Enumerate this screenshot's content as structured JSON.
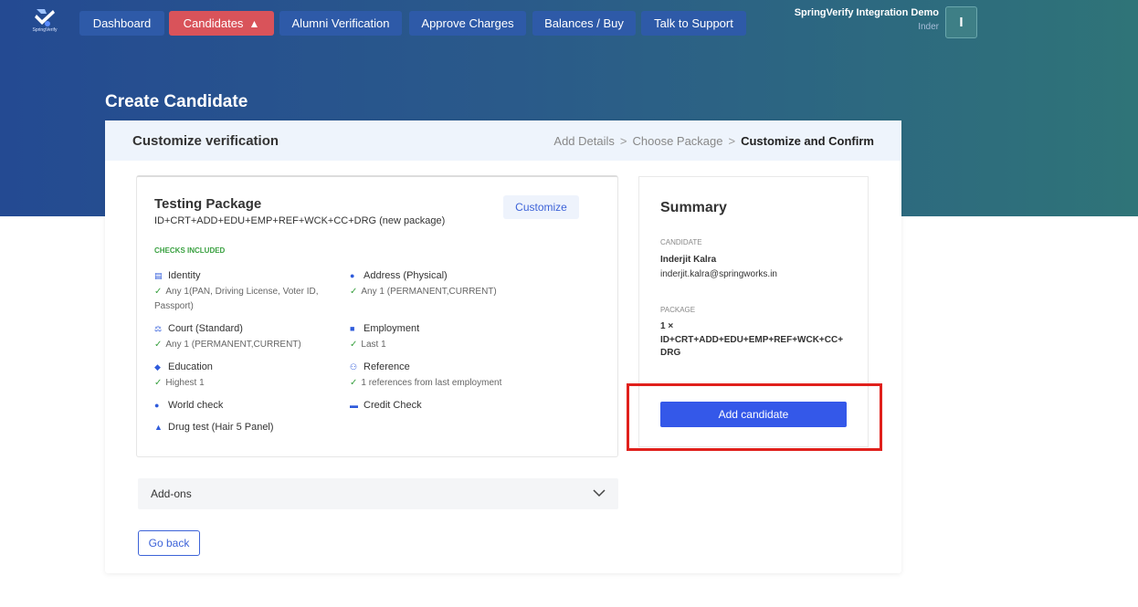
{
  "brand": {
    "logo_text": "SpringVerify"
  },
  "nav": {
    "items": [
      {
        "label": "Dashboard"
      },
      {
        "label": "Candidates"
      },
      {
        "label": "Alumni Verification"
      },
      {
        "label": "Approve Charges"
      },
      {
        "label": "Balances / Buy"
      },
      {
        "label": "Talk to Support"
      }
    ],
    "warn_icon": "warning-icon",
    "colors": {
      "active": "#d9535a",
      "item": "#2e5aa8"
    }
  },
  "user": {
    "org": "SpringVerify Integration Demo",
    "name": "Inder",
    "avatar_initial": "I"
  },
  "page": {
    "title": "Create Candidate"
  },
  "card": {
    "title": "Customize verification",
    "breadcrumb": {
      "step1": "Add Details",
      "step2": "Choose Package",
      "step3": "Customize and Confirm",
      "sep": ">"
    }
  },
  "package": {
    "name": "Testing Package",
    "code": "ID+CRT+ADD+EDU+EMP+REF+WCK+CC+DRG (new package)",
    "customize_label": "Customize",
    "checks_label": "CHECKS INCLUDED",
    "checks": [
      {
        "name": "Identity",
        "desc": "Any 1(PAN, Driving License, Voter ID, Passport)",
        "icon": "id-card-icon"
      },
      {
        "name": "Address (Physical)",
        "desc": "Any 1 (PERMANENT,CURRENT)",
        "icon": "location-pin-icon"
      },
      {
        "name": "Court (Standard)",
        "desc": "Any 1 (PERMANENT,CURRENT)",
        "icon": "gavel-icon"
      },
      {
        "name": "Employment",
        "desc": "Last 1",
        "icon": "briefcase-icon"
      },
      {
        "name": "Education",
        "desc": "Highest 1",
        "icon": "graduation-cap-icon"
      },
      {
        "name": "Reference",
        "desc": "1 references from last employment",
        "icon": "people-icon"
      },
      {
        "name": "World check",
        "desc": "",
        "icon": "globe-icon"
      },
      {
        "name": "Credit Check",
        "desc": "",
        "icon": "credit-card-icon"
      },
      {
        "name": "Drug test (Hair 5 Panel)",
        "desc": "",
        "icon": "flask-icon"
      }
    ]
  },
  "addons": {
    "label": "Add-ons"
  },
  "back": {
    "label": "Go back"
  },
  "summary": {
    "title": "Summary",
    "candidate_label": "CANDIDATE",
    "candidate_name": "Inderjit Kalra",
    "candidate_email": "inderjit.kalra@springworks.in",
    "package_label": "PACKAGE",
    "package_qty": "1 ×",
    "package_code": "ID+CRT+ADD+EDU+EMP+REF+WCK+CC+DRG",
    "add_button": "Add candidate"
  }
}
